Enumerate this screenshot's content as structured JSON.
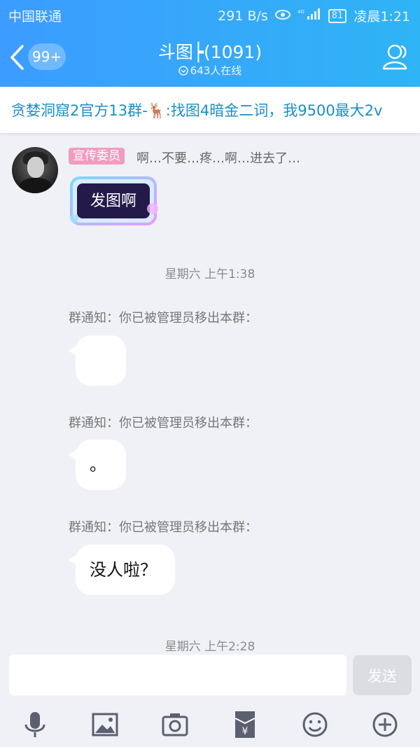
{
  "status_bar": {
    "carrier": "中国联通",
    "speed": "291 B/s",
    "network": "4G",
    "battery": "81",
    "time": "凌晨1:21"
  },
  "header": {
    "unread_badge": "99+",
    "title": "斗图┝(1091)",
    "online": "643人在线",
    "icons": [
      "back-chevron-icon",
      "members-icon",
      "online-status-icon"
    ]
  },
  "notice": {
    "text": "贪婪洞窟2官方13群-🦌:找图4暗金二词，我9500最大2v"
  },
  "messages": {
    "m1": {
      "role_tag": "宣传委员",
      "sender_text": "啊…不要…疼…啊…进去了…",
      "sticker_text": "发图啊"
    },
    "time1": "星期六 上午1:38",
    "sys1": "群通知：你已被管理员移出本群：",
    "bubble1": "",
    "sys2": "群通知：你已被管理员移出本群：",
    "bubble2": "。",
    "sys3": "群通知：你已被管理员移出本群：",
    "bubble3": "没人啦？",
    "time2": "星期六 上午2:28"
  },
  "composer": {
    "placeholder": "",
    "send_label": "发送",
    "tools": [
      "microphone-icon",
      "image-icon",
      "camera-icon",
      "red-packet-icon",
      "emoji-icon",
      "plus-icon"
    ]
  },
  "colors": {
    "header_start": "#3c9cff",
    "header_end": "#2fb4f5",
    "notice_text": "#1a8fc6",
    "role_tag": "#f29cc0"
  }
}
